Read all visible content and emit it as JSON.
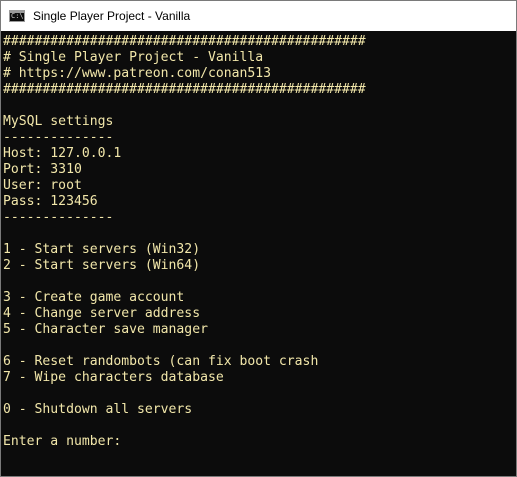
{
  "window": {
    "title": "Single Player Project - Vanilla",
    "icon": "console-icon",
    "icon_glyph": "C:\\",
    "text_color": "#f2e7aa",
    "background": "#0c0c0c"
  },
  "console": {
    "lines": [
      "##############################################",
      "# Single Player Project - Vanilla",
      "# https://www.patreon.com/conan513",
      "##############################################",
      "",
      "MySQL settings",
      "--------------",
      "Host: 127.0.0.1",
      "Port: 3310",
      "User: root",
      "Pass: 123456",
      "--------------",
      "",
      "1 - Start servers (Win32)",
      "2 - Start servers (Win64)",
      "",
      "3 - Create game account",
      "4 - Change server address",
      "5 - Character save manager",
      "",
      "6 - Reset randombots (can fix boot crash",
      "7 - Wipe characters database",
      "",
      "0 - Shutdown all servers",
      "",
      "Enter a number:"
    ]
  }
}
